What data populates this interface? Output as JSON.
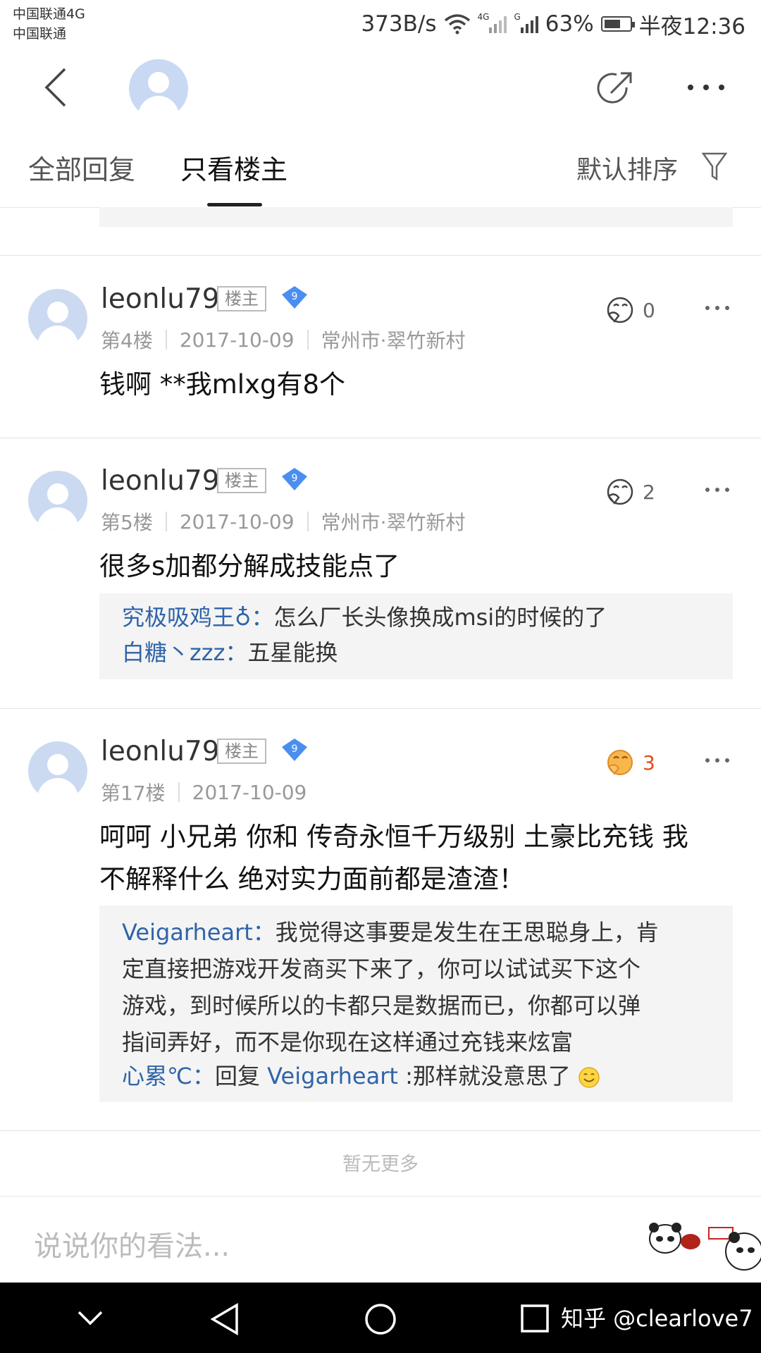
{
  "status_bar": {
    "carrier1": "中国联通4G",
    "carrier2": "中国联通",
    "net_speed": "373B/s",
    "sig1_label": "4G",
    "sig2_label": "G",
    "battery": "63%",
    "time": "半夜12:36"
  },
  "tabs": {
    "all": "全部回复",
    "host_only": "只看楼主",
    "sort": "默认排序"
  },
  "posts": [
    {
      "username": "leonlu79",
      "host_badge": "楼主",
      "level": "9",
      "floor": "第4楼",
      "date": "2017-10-09",
      "location": "常州市·翠竹新村",
      "likes": "0",
      "content": "钱啊 **我mlxg有8个"
    },
    {
      "username": "leonlu79",
      "host_badge": "楼主",
      "level": "9",
      "floor": "第5楼",
      "date": "2017-10-09",
      "location": "常州市·翠竹新村",
      "likes": "2",
      "content": "很多s加都分解成技能点了",
      "replies": [
        {
          "name": "究极吸鸡王♁：",
          "text": "怎么厂长头像换成msi的时候的了"
        },
        {
          "name": "白糖丶zzz：",
          "text": "五星能换"
        }
      ]
    },
    {
      "username": "leonlu79",
      "host_badge": "楼主",
      "level": "9",
      "floor": "第17楼",
      "date": "2017-10-09",
      "likes": "3",
      "content_line1": "呵呵 小兄弟 你和 传奇永恒千万级别 土豪比充钱 我",
      "content_line2": "不解释什么 绝对实力面前都是渣渣！",
      "replies": [
        {
          "name": "Veigarheart：",
          "lines": [
            "我觉得这事要是发生在王思聪身上，肯",
            "定直接把游戏开发商买下来了，你可以试试买下这个",
            "游戏，到时候所以的卡都只是数据而已，你都可以弹",
            "指间弄好，而不是你现在这样通过充钱来炫富"
          ]
        },
        {
          "name": "心累℃：",
          "prefix": "回复 ",
          "mention": "Veigarheart",
          "text": " :那样就没意思了"
        }
      ]
    }
  ],
  "footer": {
    "no_more": "暂无更多",
    "input_placeholder": "说说你的看法..."
  },
  "watermark": "知乎 @clearlove7",
  "colors": {
    "link_blue": "#2f64a8",
    "hot_orange": "#e24e1b",
    "avatar_bg": "#cbdaf1",
    "level_badge": "#4a8ff0"
  }
}
